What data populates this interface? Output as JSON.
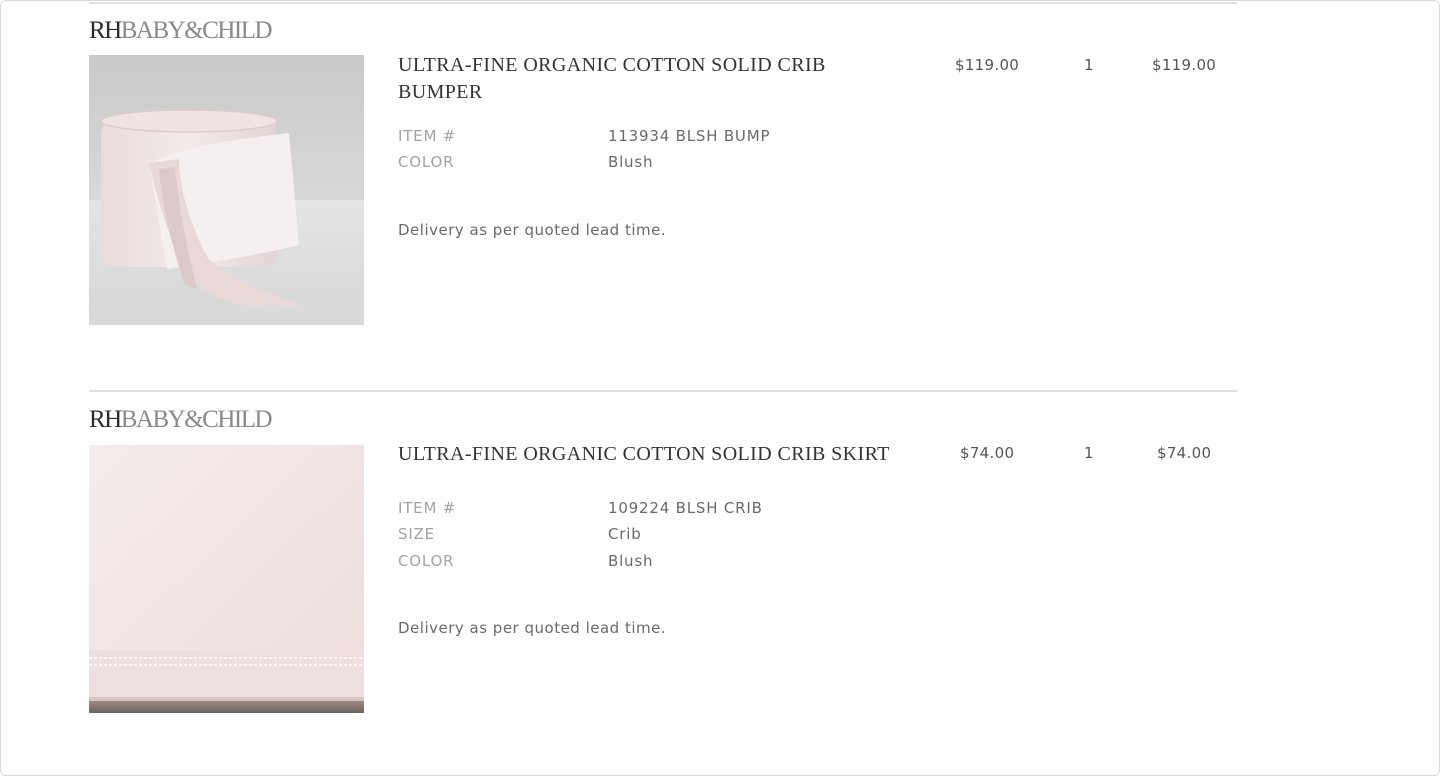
{
  "items": [
    {
      "brand_primary": "RH",
      "brand_secondary": "BABY&CHILD",
      "title": "ULTRA-FINE ORGANIC COTTON SOLID CRIB BUMPER",
      "price": "$119.00",
      "quantity": "1",
      "total": "$119.00",
      "attributes": [
        {
          "label": "ITEM #",
          "value": "113934 BLSH BUMP"
        },
        {
          "label": "COLOR",
          "value": "Blush"
        }
      ],
      "note": "Delivery as per quoted lead time."
    },
    {
      "brand_primary": "RH",
      "brand_secondary": "BABY&CHILD",
      "title": "ULTRA-FINE ORGANIC COTTON SOLID CRIB SKIRT",
      "price": "$74.00",
      "quantity": "1",
      "total": "$74.00",
      "attributes": [
        {
          "label": "ITEM #",
          "value": "109224 BLSH CRIB"
        },
        {
          "label": "SIZE",
          "value": "Crib"
        },
        {
          "label": "COLOR",
          "value": "Blush"
        }
      ],
      "note": "Delivery as per quoted lead time."
    }
  ],
  "colors": {
    "blush": "#f1e6e6",
    "rule": "#e1e1e1",
    "brand_dark": "#2c2c2c",
    "brand_light": "#8a8a8a"
  }
}
